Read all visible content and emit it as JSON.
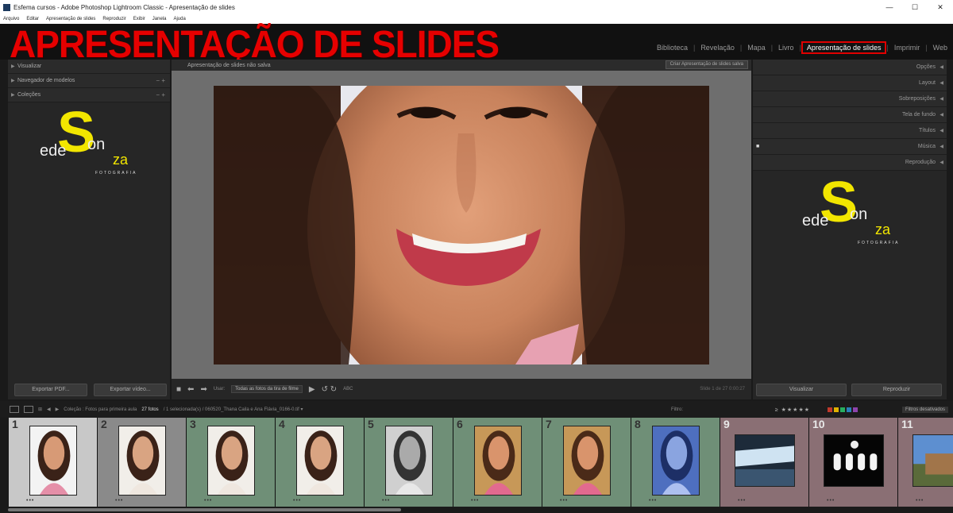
{
  "window": {
    "title": "Esfema cursos - Adobe Photoshop Lightroom Classic - Apresentação de slides",
    "minimize": "—",
    "maximize": "☐",
    "close": "✕"
  },
  "menu": [
    "Arquivo",
    "Editar",
    "Apresentação de slides",
    "Reproduzir",
    "Exibir",
    "Janela",
    "Ajuda"
  ],
  "overlay_title": "APRESENTAÇÃO DE SLIDES",
  "modules": [
    "Biblioteca",
    "Revelação",
    "Mapa",
    "Livro",
    "Apresentação de slides",
    "Imprimir",
    "Web"
  ],
  "active_module": "Apresentação de slides",
  "left_panel": {
    "sections": [
      "Visualizar",
      "Navegador de modelos",
      "Coleções"
    ],
    "export_pdf": "Exportar PDF...",
    "export_video": "Exportar vídeo..."
  },
  "logo": {
    "s": "S",
    "ede": "ede",
    "on": "on",
    "za": "za",
    "tagline": "FOTOGRAFIA"
  },
  "center": {
    "header": "Apresentação de slides não salva",
    "create_button": "Criar Apresentação de slides salva",
    "toolbar_use_label": "Usar:",
    "toolbar_use_value": "Todas as fotos da tira de filme",
    "toolbar_text_tool": "ABC",
    "slide_counter": "Slide 1 de 27  0:00:27"
  },
  "right_panel": {
    "sections": [
      "Opções",
      "Layout",
      "Sobreposições",
      "Tela de fundo",
      "Títulos",
      "Música",
      "Reprodução"
    ],
    "preview": "Visualizar",
    "play": "Reproduzir"
  },
  "filmstrip_bar": {
    "collection": "Coleção : Fotos para primeira aula",
    "count": "27 fotos",
    "selection": "/ 1 selecionada(s) / 060520_Thana Caila e Ana Flávia_0166-0.tif ▾",
    "filter_label": "Filtro:",
    "filters_off": "Filtros desativados",
    "colors": [
      "#c0392b",
      "#e0b100",
      "#27ae60",
      "#2980b9",
      "#8e44ad"
    ],
    "stars": "≥ ★★★★★"
  },
  "filmstrip": [
    {
      "n": "1",
      "bg": "#c8c8c8",
      "photo": "color",
      "dots": "•••"
    },
    {
      "n": "2",
      "bg": "#8a8a8a",
      "photo": "color-soft",
      "dots": "•••"
    },
    {
      "n": "3",
      "bg": "#6f8f77",
      "photo": "color-soft",
      "dots": "•••"
    },
    {
      "n": "4",
      "bg": "#6f8f77",
      "photo": "color-soft",
      "dots": "•••"
    },
    {
      "n": "5",
      "bg": "#6f8f77",
      "photo": "bw",
      "dots": "•••"
    },
    {
      "n": "6",
      "bg": "#6f8f77",
      "photo": "warm",
      "dots": "•••"
    },
    {
      "n": "7",
      "bg": "#6f8f77",
      "photo": "warm",
      "dots": "•••"
    },
    {
      "n": "8",
      "bg": "#6f8f77",
      "photo": "blue",
      "dots": "•••"
    },
    {
      "n": "9",
      "bg": "#8a6f74",
      "photo": "waterfall",
      "dots": "•••"
    },
    {
      "n": "10",
      "bg": "#8a6f74",
      "photo": "windows",
      "dots": "•••"
    },
    {
      "n": "11",
      "bg": "#8a6f74",
      "photo": "house",
      "dots": "•••"
    }
  ]
}
